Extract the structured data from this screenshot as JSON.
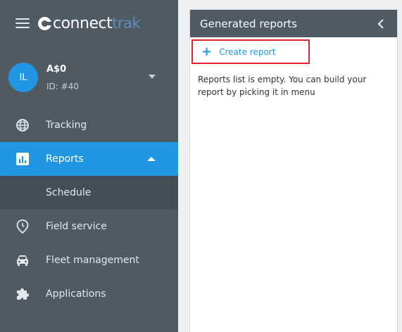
{
  "app": {
    "logo_primary": "connect",
    "logo_secondary": "trak",
    "accent_color": "#2196e3",
    "sidebar_color": "#4f5a63"
  },
  "user": {
    "initials": "IL",
    "name": "A$0",
    "id": "ID: #40"
  },
  "sidebar": {
    "items": [
      {
        "label": "Tracking",
        "icon": "globe-icon"
      },
      {
        "label": "Reports",
        "icon": "bar-chart-icon",
        "active": true
      },
      {
        "label": "Schedule",
        "sub": true
      },
      {
        "label": "Field service",
        "icon": "location-pin-icon"
      },
      {
        "label": "Fleet management",
        "icon": "car-icon"
      },
      {
        "label": "Applications",
        "icon": "puzzle-icon"
      }
    ]
  },
  "panel": {
    "title": "Generated reports",
    "create_label": "Create report",
    "empty_message": "Reports list is empty. You can build your report by picking it in menu"
  }
}
